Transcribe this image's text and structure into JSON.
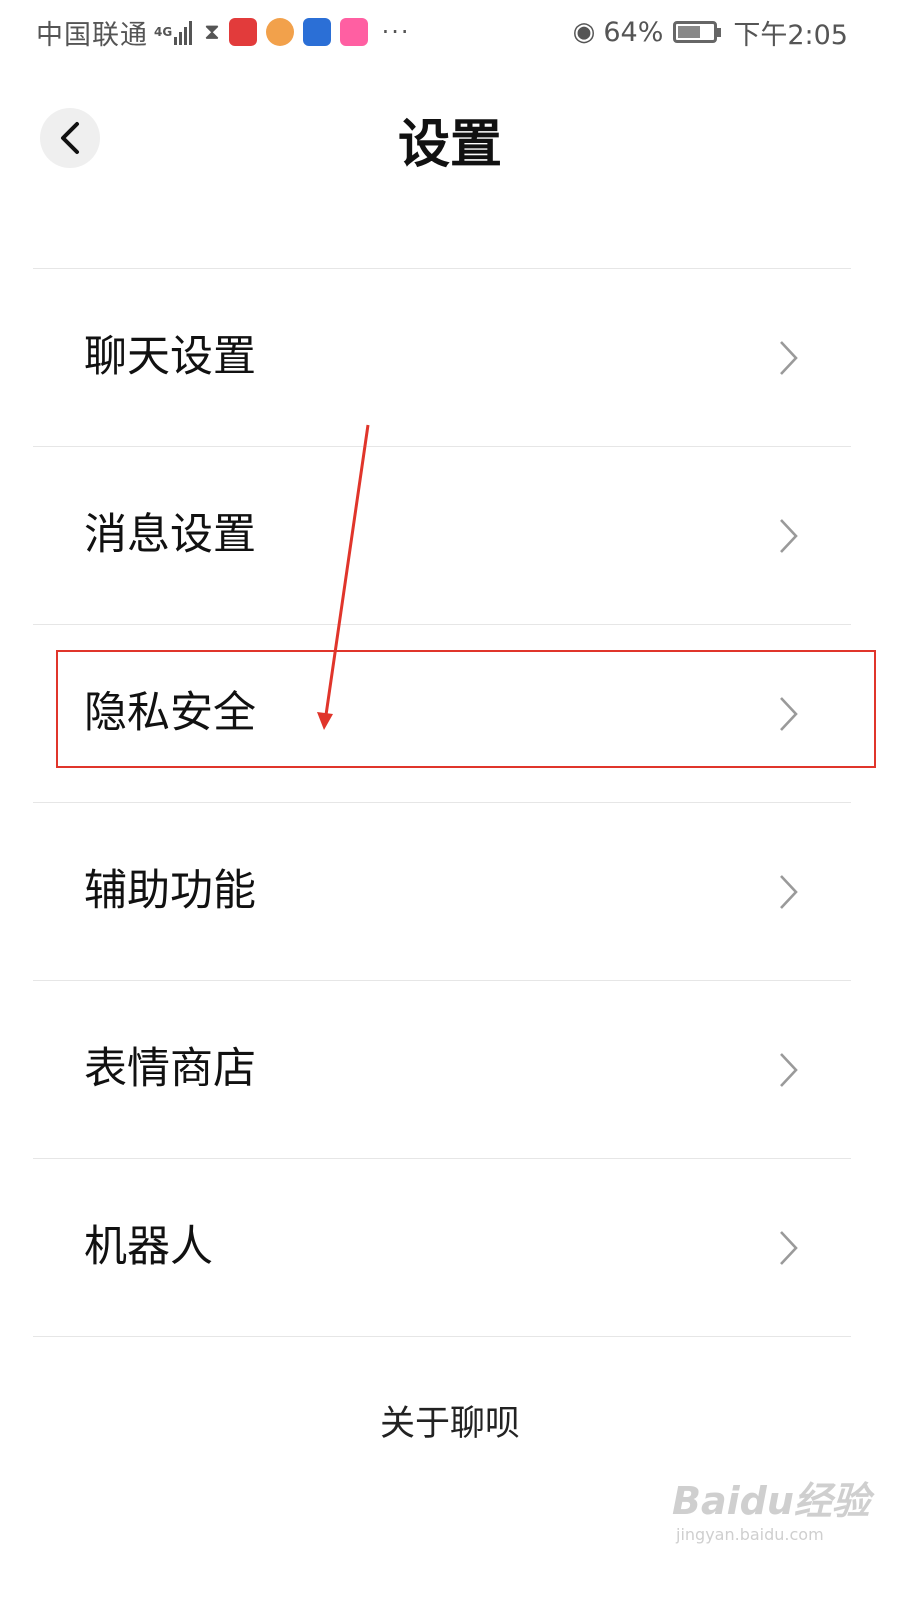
{
  "status_bar": {
    "carrier": "中国联通",
    "network": "4G",
    "battery_percent": "64%",
    "battery_level": 0.64,
    "time": "下午2:05",
    "overflow": "···"
  },
  "header": {
    "title": "设置",
    "back_icon": "chevron-left-icon"
  },
  "menu": {
    "items": [
      {
        "label": "聊天设置"
      },
      {
        "label": "消息设置"
      },
      {
        "label": "隐私安全",
        "highlighted": true
      },
      {
        "label": "辅助功能"
      },
      {
        "label": "表情商店"
      },
      {
        "label": "机器人"
      }
    ]
  },
  "footer": {
    "about": "关于聊呗"
  },
  "watermark": {
    "logo": "Baidu经验",
    "url": "jingyan.baidu.com"
  },
  "colors": {
    "annotation": "#e0352b",
    "divider": "#e6e6e6",
    "chevron": "#9a9a9a"
  }
}
